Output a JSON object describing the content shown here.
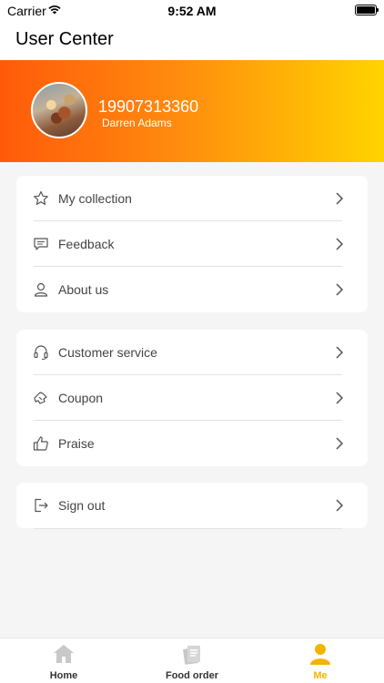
{
  "status_bar": {
    "carrier": "Carrier",
    "time": "9:52 AM"
  },
  "nav": {
    "title": "User Center"
  },
  "profile": {
    "phone": "19907313360",
    "name": "Darren Adams"
  },
  "menu_group_1": [
    {
      "label": "My collection",
      "icon": "star-icon"
    },
    {
      "label": "Feedback",
      "icon": "message-icon"
    },
    {
      "label": "About us",
      "icon": "person-icon"
    }
  ],
  "menu_group_2": [
    {
      "label": "Customer service",
      "icon": "headset-icon"
    },
    {
      "label": "Coupon",
      "icon": "coupon-icon"
    },
    {
      "label": "Praise",
      "icon": "thumbs-up-icon"
    }
  ],
  "menu_group_3": [
    {
      "label": "Sign out",
      "icon": "sign-out-icon"
    }
  ],
  "tabs": [
    {
      "label": "Home",
      "icon": "home-icon",
      "active": false
    },
    {
      "label": "Food order",
      "icon": "food-order-icon",
      "active": false
    },
    {
      "label": "Me",
      "icon": "person-icon",
      "active": true
    }
  ],
  "colors": {
    "accent": "#f3b400",
    "banner_start": "#ff5a0a",
    "banner_end": "#ffd400"
  }
}
